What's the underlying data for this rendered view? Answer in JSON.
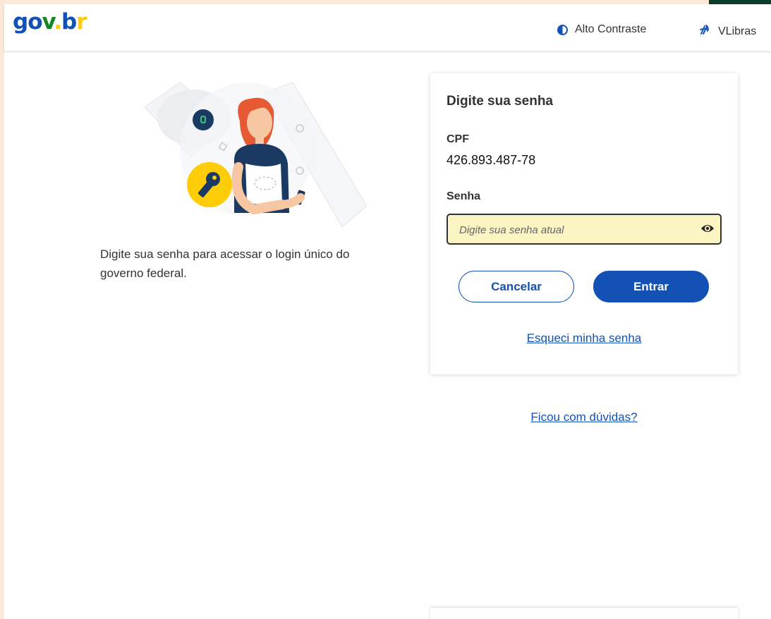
{
  "header": {
    "logo": {
      "g": "g",
      "o": "o",
      "v": "v",
      "dot": ".",
      "b": "b",
      "r": "r"
    },
    "contrast_label": "Alto Contraste",
    "libras_label": "VLibras"
  },
  "intro": {
    "text": "Digite sua senha para acessar o login único do governo federal."
  },
  "card": {
    "title": "Digite sua senha",
    "cpf_label": "CPF",
    "cpf_value": "426.893.487-78",
    "password_label": "Senha",
    "password_placeholder": "Digite sua senha atual",
    "cancel_label": "Cancelar",
    "enter_label": "Entrar",
    "forgot_label": "Esqueci minha senha"
  },
  "help": {
    "doubts_label": "Ficou com dúvidas?"
  },
  "colors": {
    "primary": "#1351b4",
    "green": "#168821",
    "yellow": "#ffcd07",
    "field_bg": "#fbf4c3"
  },
  "icons": [
    "contrast-icon",
    "sign-language-icon",
    "eye-icon",
    "key-icon",
    "lock-icon"
  ]
}
